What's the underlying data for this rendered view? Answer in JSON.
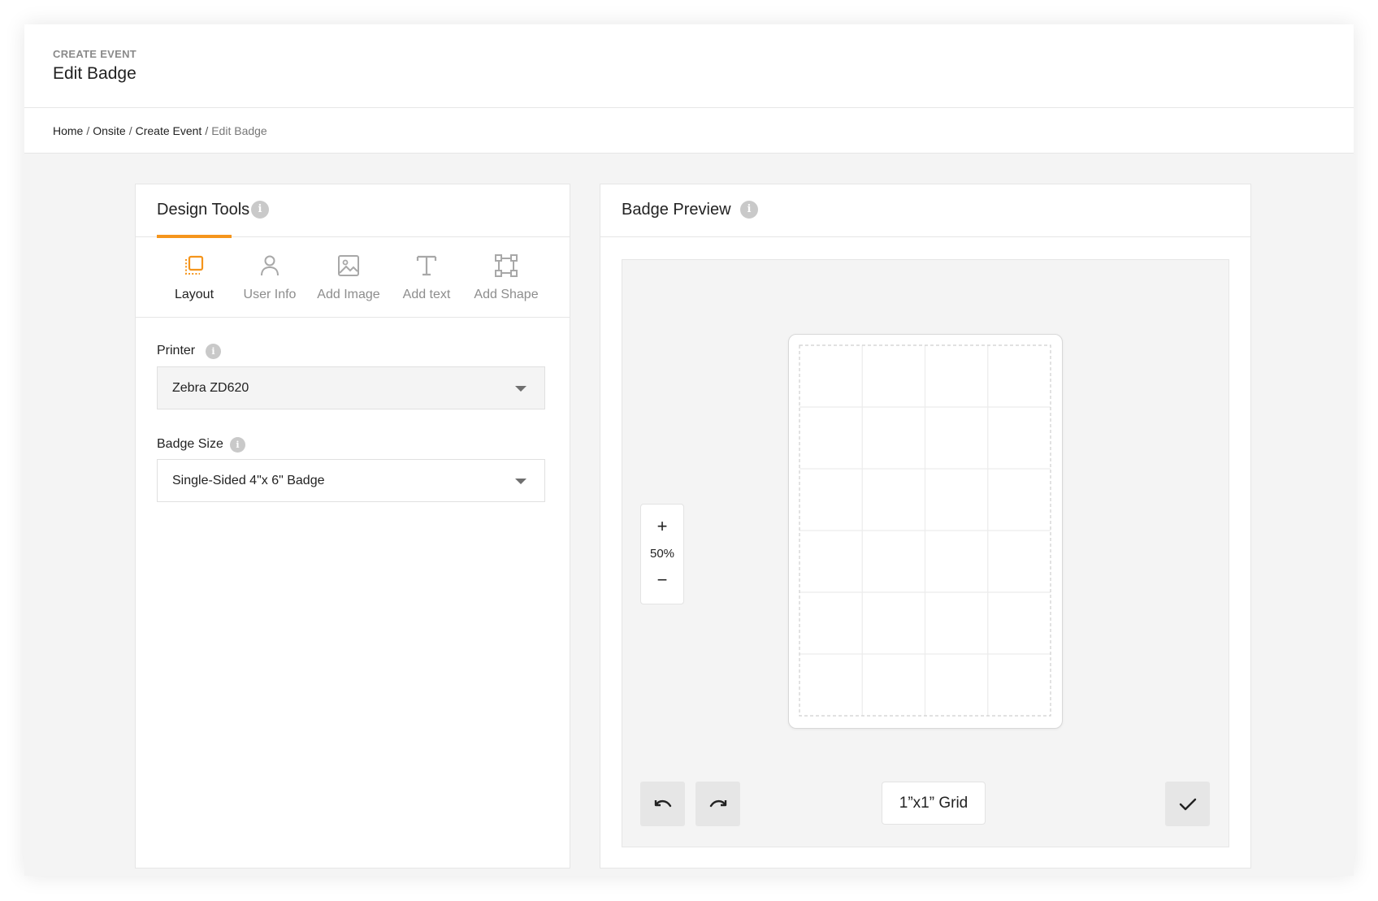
{
  "header": {
    "eyebrow": "CREATE EVENT",
    "title": "Edit Badge"
  },
  "breadcrumb": {
    "items": [
      "Home",
      "Onsite",
      "Create Event"
    ],
    "current": "Edit Badge",
    "separator": "/"
  },
  "design_tools": {
    "title": "Design Tools",
    "info_glyph": "i",
    "active_tab": "Layout",
    "accent_color": "#f5951c",
    "tools": [
      {
        "label": "Layout",
        "icon": "layout-icon"
      },
      {
        "label": "User Info",
        "icon": "user-icon"
      },
      {
        "label": "Add Image",
        "icon": "image-icon"
      },
      {
        "label": "Add text",
        "icon": "text-icon"
      },
      {
        "label": "Add Shape",
        "icon": "shape-icon"
      }
    ],
    "printer": {
      "label": "Printer",
      "value": "Zebra ZD620"
    },
    "badge_size": {
      "label": "Badge Size",
      "value": "Single-Sided 4\"x 6\" Badge"
    }
  },
  "badge_preview": {
    "title": "Badge Preview",
    "info_glyph": "i",
    "zoom": {
      "plus": "+",
      "minus": "−",
      "level": "50%"
    },
    "grid_toggle": "1”x1” Grid",
    "grid": {
      "columns": 4,
      "rows": 6
    },
    "actions": [
      "undo-icon",
      "redo-icon",
      "check-icon"
    ]
  }
}
